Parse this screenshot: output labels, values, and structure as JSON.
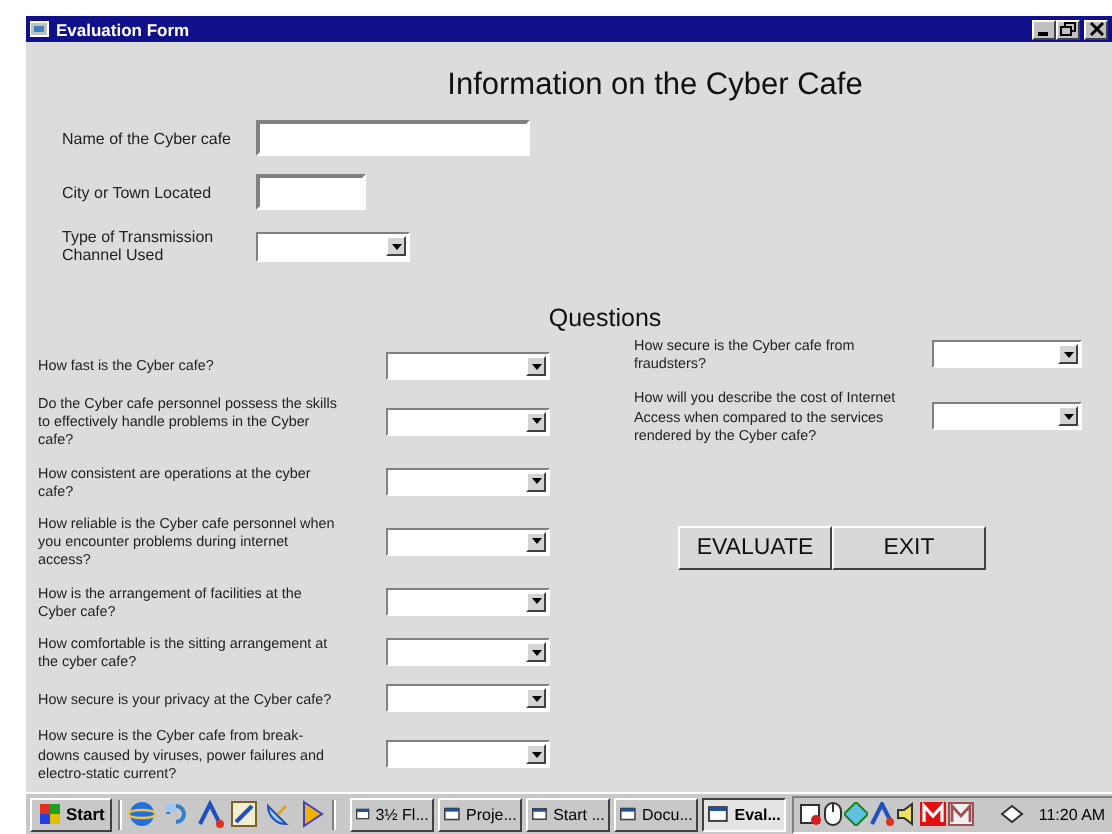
{
  "window": {
    "title": "Evaluation Form"
  },
  "header": "Information on the Cyber Cafe",
  "fields": [
    {
      "label": "Name of the Cyber cafe",
      "kind": "text"
    },
    {
      "label": "City or Town Located",
      "kind": "text"
    },
    {
      "label": "Type of Transmission Channel Used",
      "kind": "combo"
    }
  ],
  "section_title": "Questions",
  "questions_left": [
    {
      "text": "How fast is the Cyber cafe?"
    },
    {
      "text": "Do the Cyber cafe personnel possess the skills to effectively handle problems in the Cyber cafe?"
    },
    {
      "text": "How consistent are operations at the cyber cafe?"
    },
    {
      "text": "How reliable is the Cyber cafe personnel when you encounter problems during internet access?"
    },
    {
      "text": "How is the arrangement of facilities at the Cyber cafe?"
    },
    {
      "text": "How comfortable is the sitting arrangement at the cyber cafe?"
    },
    {
      "text": "How secure is your privacy at the Cyber cafe?"
    },
    {
      "text": "How secure is the Cyber cafe from break-downs caused by viruses, power failures and electro-static current?"
    }
  ],
  "questions_right": [
    {
      "text": "How secure is the Cyber cafe from fraudsters?"
    },
    {
      "text": "How will you describe the cost of Internet Access when compared to the services rendered by the Cyber cafe?"
    }
  ],
  "buttons": [
    "EVALUATE",
    "EXIT"
  ],
  "taskbar": {
    "start": "Start",
    "tasks": [
      {
        "label": "3½ Fl...",
        "selected": false
      },
      {
        "label": "Proje...",
        "selected": false
      },
      {
        "label": "Start ...",
        "selected": false
      },
      {
        "label": "Docu...",
        "selected": false
      },
      {
        "label": "Eval...",
        "selected": true
      }
    ],
    "clock": "11:20 AM"
  }
}
